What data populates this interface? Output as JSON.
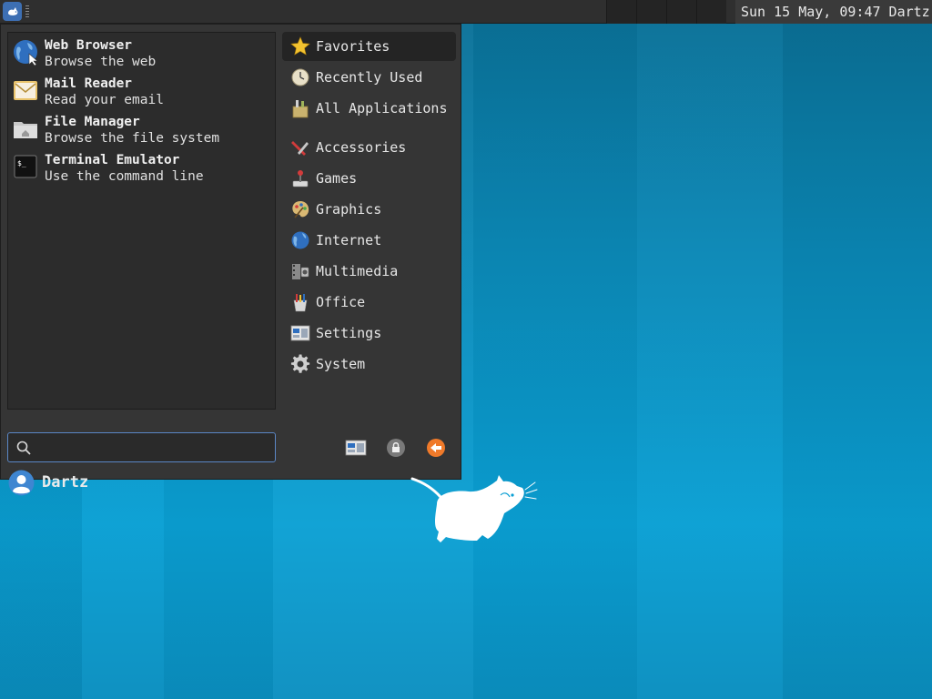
{
  "panel": {
    "clock_text": "Sun 15 May, 09:47 Dartz",
    "menu_button_icon": "xfce-mouse-icon",
    "workspace_count": 4
  },
  "favorites": [
    {
      "name": "Web Browser",
      "description": "Browse the web",
      "icon": "globe-icon"
    },
    {
      "name": "Mail Reader",
      "description": "Read your email",
      "icon": "mail-icon"
    },
    {
      "name": "File Manager",
      "description": "Browse the file system",
      "icon": "folder-icon"
    },
    {
      "name": "Terminal Emulator",
      "description": "Use the command line",
      "icon": "terminal-icon"
    }
  ],
  "categories": [
    {
      "label": "Favorites",
      "icon": "star-icon",
      "selected": true
    },
    {
      "label": "Recently Used",
      "icon": "clock-icon"
    },
    {
      "label": "All Applications",
      "icon": "toolbox-icon"
    },
    {
      "label": "Accessories",
      "icon": "tools-icon"
    },
    {
      "label": "Games",
      "icon": "joystick-icon"
    },
    {
      "label": "Graphics",
      "icon": "palette-icon"
    },
    {
      "label": "Internet",
      "icon": "globe-icon"
    },
    {
      "label": "Multimedia",
      "icon": "film-icon"
    },
    {
      "label": "Office",
      "icon": "office-icon"
    },
    {
      "label": "Settings",
      "icon": "settings-icon"
    },
    {
      "label": "System",
      "icon": "gear-icon"
    }
  ],
  "search": {
    "placeholder": "",
    "value": ""
  },
  "actions": [
    {
      "name": "settings-manager-button",
      "icon": "settings-icon"
    },
    {
      "name": "lock-screen-button",
      "icon": "lock-icon"
    },
    {
      "name": "log-out-button",
      "icon": "logout-icon"
    }
  ],
  "user": {
    "name": "Dartz"
  },
  "colors": {
    "accent": "#5b87c6",
    "logout": "#f07a2a",
    "desktop": "#0a9fd4"
  }
}
